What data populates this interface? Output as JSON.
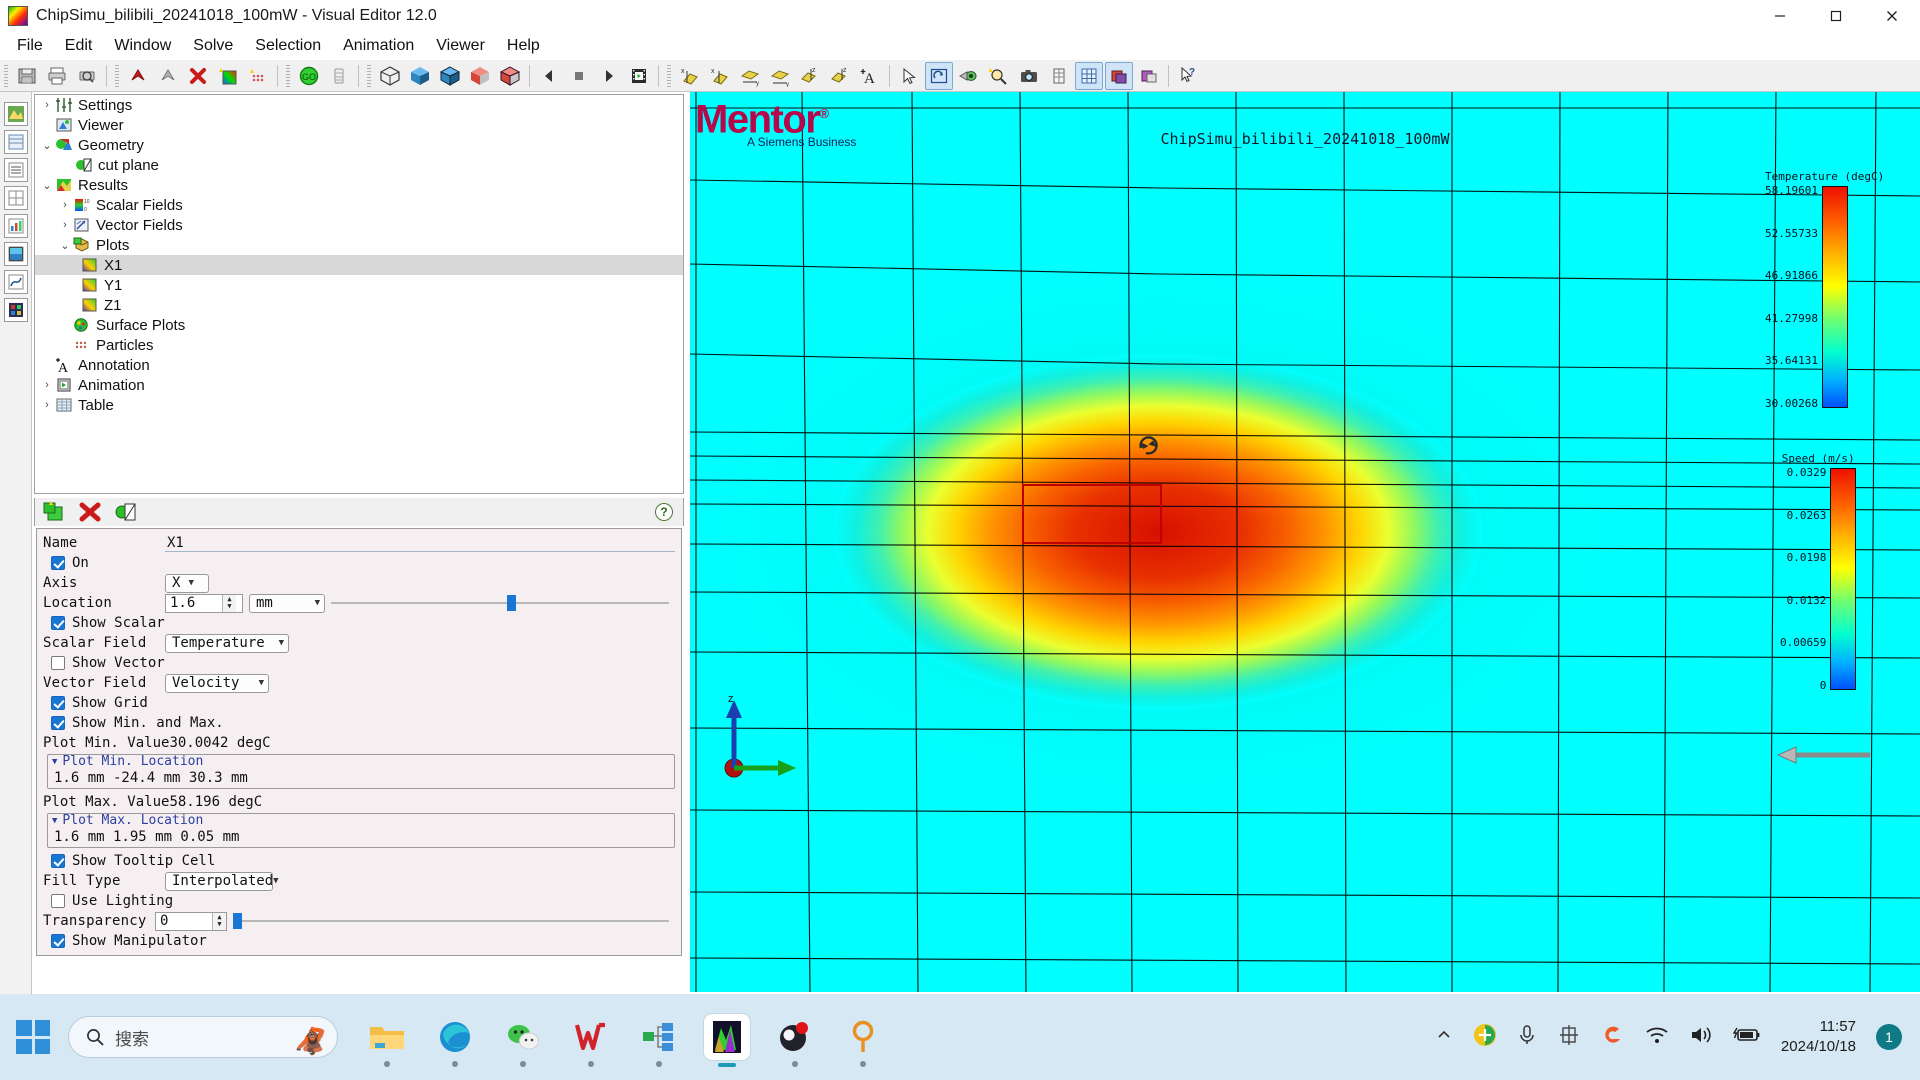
{
  "window": {
    "title": "ChipSimu_bilibili_20241018_100mW - Visual Editor 12.0",
    "app_icon": "colormap-icon",
    "minimize_label": "Minimize",
    "maximize_label": "Maximize",
    "close_label": "Close"
  },
  "menubar": {
    "items": [
      {
        "label": "File"
      },
      {
        "label": "Edit"
      },
      {
        "label": "Window"
      },
      {
        "label": "Solve"
      },
      {
        "label": "Selection"
      },
      {
        "label": "Animation"
      },
      {
        "label": "Viewer"
      },
      {
        "label": "Help"
      }
    ]
  },
  "toolbar": {
    "groups": [
      {
        "buttons": [
          {
            "name": "save-icon"
          },
          {
            "name": "print-icon"
          },
          {
            "name": "print-preview-icon"
          }
        ]
      },
      {
        "buttons": [
          {
            "name": "undo-icon"
          },
          {
            "name": "redo-icon"
          },
          {
            "name": "delete-icon"
          },
          {
            "name": "new-plot-icon"
          },
          {
            "name": "new-particles-icon"
          }
        ]
      },
      {
        "buttons": [
          {
            "name": "go-solve-icon"
          },
          {
            "name": "mesh-icon"
          }
        ]
      },
      {
        "buttons": [
          {
            "name": "wireframe-view-icon"
          },
          {
            "name": "solid-blue-view-icon"
          },
          {
            "name": "outline-blue-view-icon"
          },
          {
            "name": "solid-red-view-icon"
          },
          {
            "name": "outline-red-view-icon"
          }
        ]
      },
      {
        "buttons": [
          {
            "name": "play-back-icon"
          },
          {
            "name": "stop-icon"
          },
          {
            "name": "play-forward-icon"
          },
          {
            "name": "film-icon"
          }
        ]
      },
      {
        "buttons": [
          {
            "name": "cut-plane-x-icon"
          },
          {
            "name": "cut-plane-x2-icon"
          },
          {
            "name": "cut-plane-y-icon"
          },
          {
            "name": "cut-plane-y2-icon"
          },
          {
            "name": "cut-plane-z-icon"
          },
          {
            "name": "cut-plane-z2-icon"
          },
          {
            "name": "add-annotation-icon"
          }
        ]
      },
      {
        "buttons": [
          {
            "name": "select-pointer-icon"
          },
          {
            "name": "rotate-view-icon"
          },
          {
            "name": "pan-view-icon"
          },
          {
            "name": "zoom-view-icon"
          },
          {
            "name": "snapshot-icon"
          },
          {
            "name": "table-icon"
          },
          {
            "name": "grid-toggle-icon"
          },
          {
            "name": "layers-icon"
          },
          {
            "name": "color-toggle-icon"
          }
        ]
      },
      {
        "buttons": [
          {
            "name": "help-pointer-icon"
          }
        ]
      }
    ]
  },
  "left_rail": {
    "buttons": [
      {
        "name": "rail-model-icon"
      },
      {
        "name": "rail-sheet-icon"
      },
      {
        "name": "rail-list-icon"
      },
      {
        "name": "rail-grid-icon"
      },
      {
        "name": "rail-chart-icon"
      },
      {
        "name": "rail-bars-icon"
      },
      {
        "name": "rail-curve-icon"
      },
      {
        "name": "rail-image-icon"
      }
    ]
  },
  "tree": {
    "nodes": [
      {
        "label": "Settings",
        "indent": 0,
        "twisty": "collapsed",
        "icon": "settings-icon",
        "selected": false
      },
      {
        "label": "Viewer",
        "indent": 0,
        "twisty": "none",
        "icon": "viewer-icon",
        "selected": false
      },
      {
        "label": "Geometry",
        "indent": 0,
        "twisty": "expanded",
        "icon": "geometry-icon",
        "selected": false
      },
      {
        "label": "cut plane",
        "indent": 1,
        "twisty": "none",
        "icon": "cut-plane-icon",
        "selected": false
      },
      {
        "label": "Results",
        "indent": 0,
        "twisty": "expanded",
        "icon": "results-icon",
        "selected": false
      },
      {
        "label": "Scalar Fields",
        "indent": 1,
        "twisty": "collapsed",
        "icon": "scalar-fields-icon",
        "selected": false
      },
      {
        "label": "Vector Fields",
        "indent": 1,
        "twisty": "collapsed",
        "icon": "vector-fields-icon",
        "selected": false
      },
      {
        "label": "Plots",
        "indent": 1,
        "twisty": "expanded",
        "icon": "plots-icon",
        "selected": false
      },
      {
        "label": "X1",
        "indent": 2,
        "twisty": "none",
        "icon": "plot-x-icon",
        "selected": true
      },
      {
        "label": "Y1",
        "indent": 2,
        "twisty": "none",
        "icon": "plot-y-icon",
        "selected": false
      },
      {
        "label": "Z1",
        "indent": 2,
        "twisty": "none",
        "icon": "plot-z-icon",
        "selected": false
      },
      {
        "label": "Surface Plots",
        "indent": 1,
        "twisty": "none",
        "icon": "surface-plots-icon",
        "selected": false
      },
      {
        "label": "Particles",
        "indent": 1,
        "twisty": "none",
        "icon": "particles-icon",
        "selected": false
      },
      {
        "label": "Annotation",
        "indent": 0,
        "twisty": "none",
        "icon": "annotation-icon",
        "selected": false
      },
      {
        "label": "Animation",
        "indent": 0,
        "twisty": "collapsed",
        "icon": "animation-icon",
        "selected": false
      },
      {
        "label": "Table",
        "indent": 0,
        "twisty": "collapsed",
        "icon": "table-tree-icon",
        "selected": false
      }
    ]
  },
  "prop_toolbar": {
    "buttons": [
      {
        "name": "new-plot-button"
      },
      {
        "name": "delete-plot-button"
      },
      {
        "name": "toggle-plot-button"
      }
    ],
    "help_label": "?"
  },
  "properties": {
    "name_label": "Name",
    "name_value": "X1",
    "on_label": "On",
    "on_checked": true,
    "axis_label": "Axis",
    "axis_value": "X",
    "location_label": "Location",
    "location_value": "1.6",
    "location_unit": "mm",
    "location_slider_pct": 52,
    "show_scalar_label": "Show Scalar",
    "show_scalar_checked": true,
    "scalar_field_label": "Scalar Field",
    "scalar_field_value": "Temperature",
    "show_vector_label": "Show  Vector",
    "show_vector_checked": false,
    "vector_field_label": "Vector Field",
    "vector_field_value": "Velocity",
    "show_grid_label": "Show Grid",
    "show_grid_checked": true,
    "show_minmax_label": "Show Min. and Max.",
    "show_minmax_checked": true,
    "plot_min_value_label": "Plot Min. Value",
    "plot_min_value": "30.0042 degC",
    "plot_min_location_label": "Plot Min. Location",
    "plot_min_location": "1.6 mm  -24.4 mm  30.3 mm",
    "plot_max_value_label": "Plot Max. Value",
    "plot_max_value": "58.196 degC",
    "plot_max_location_label": "Plot Max. Location",
    "plot_max_location": "1.6 mm  1.95 mm  0.05 mm",
    "show_tooltip_label": "Show Tooltip Cell",
    "show_tooltip_checked": true,
    "fill_type_label": "Fill Type",
    "fill_type_value": "Interpolated",
    "use_lighting_label": "Use Lighting",
    "use_lighting_checked": false,
    "transparency_label": "Transparency",
    "transparency_value": "0",
    "transparency_slider_pct": 0,
    "show_manipulator_label": "Show Manipulator",
    "show_manipulator_checked": true
  },
  "viewport": {
    "brand_name": "Mentor",
    "brand_registered": "®",
    "brand_tagline": "A Siemens Business",
    "plot_title": "ChipSimu_bilibili_20241018_100mW",
    "rotate_cursor": "rotate-cursor-icon",
    "axis_z_label": "z",
    "background_color": "#00ffff"
  },
  "chart_data": {
    "type": "heatmap",
    "title": "ChipSimu_bilibili_20241018_100mW",
    "description": "Cut-plane contour of temperature field on plane X = 1.6 mm",
    "legends": [
      {
        "name": "temperature",
        "title": "Temperature (degC)",
        "unit": "degC",
        "ticks": [
          "58.19601",
          "52.55733",
          "46.91866",
          "41.27998",
          "35.64131",
          "30.00268"
        ],
        "min": 30.00268,
        "max": 58.19601,
        "colormap": [
          "#0050ff",
          "#00b0ff",
          "#00ffd0",
          "#70ff70",
          "#ffff00",
          "#ffb000",
          "#ff6000",
          "#ee1100"
        ]
      },
      {
        "name": "speed",
        "title": "Speed (m/s)",
        "unit": "m/s",
        "ticks": [
          "0.0329",
          "0.0263",
          "0.0198",
          "0.0132",
          "0.00659",
          "0"
        ],
        "min": 0,
        "max": 0.0329,
        "colormap": [
          "#0050ff",
          "#00b0ff",
          "#00ffd0",
          "#70ff70",
          "#ffff00",
          "#ffb000",
          "#ff6000",
          "#ee1100"
        ]
      }
    ],
    "annotations": [
      {
        "label": "plot maximum location",
        "value": "1.6 mm 1.95 mm 0.05 mm"
      },
      {
        "label": "plot minimum location",
        "value": "1.6 mm -24.4 mm 30.3 mm"
      }
    ]
  },
  "taskbar": {
    "start_label": "Start",
    "search_placeholder": "搜索",
    "search_icon": "search-icon",
    "items": [
      {
        "name": "file-explorer-icon",
        "running": true,
        "active": false
      },
      {
        "name": "microsoft-edge-icon",
        "running": true,
        "active": false
      },
      {
        "name": "wechat-icon",
        "running": true,
        "active": false
      },
      {
        "name": "wps-office-icon",
        "running": true,
        "active": false
      },
      {
        "name": "xmind-icon",
        "running": true,
        "active": false
      },
      {
        "name": "visual-editor-icon",
        "running": true,
        "active": true
      },
      {
        "name": "obs-studio-icon",
        "running": true,
        "active": false
      },
      {
        "name": "everything-icon",
        "running": true,
        "active": false
      }
    ],
    "tray": [
      {
        "name": "chevron-up-icon"
      },
      {
        "name": "security-shield-icon"
      },
      {
        "name": "microphone-icon"
      },
      {
        "name": "ime-chinese-icon",
        "label": "中"
      },
      {
        "name": "sogou-icon"
      },
      {
        "name": "wifi-icon"
      },
      {
        "name": "volume-icon"
      },
      {
        "name": "battery-icon"
      }
    ],
    "clock_time": "11:57",
    "clock_date": "2024/10/18",
    "notification_count": "1"
  }
}
